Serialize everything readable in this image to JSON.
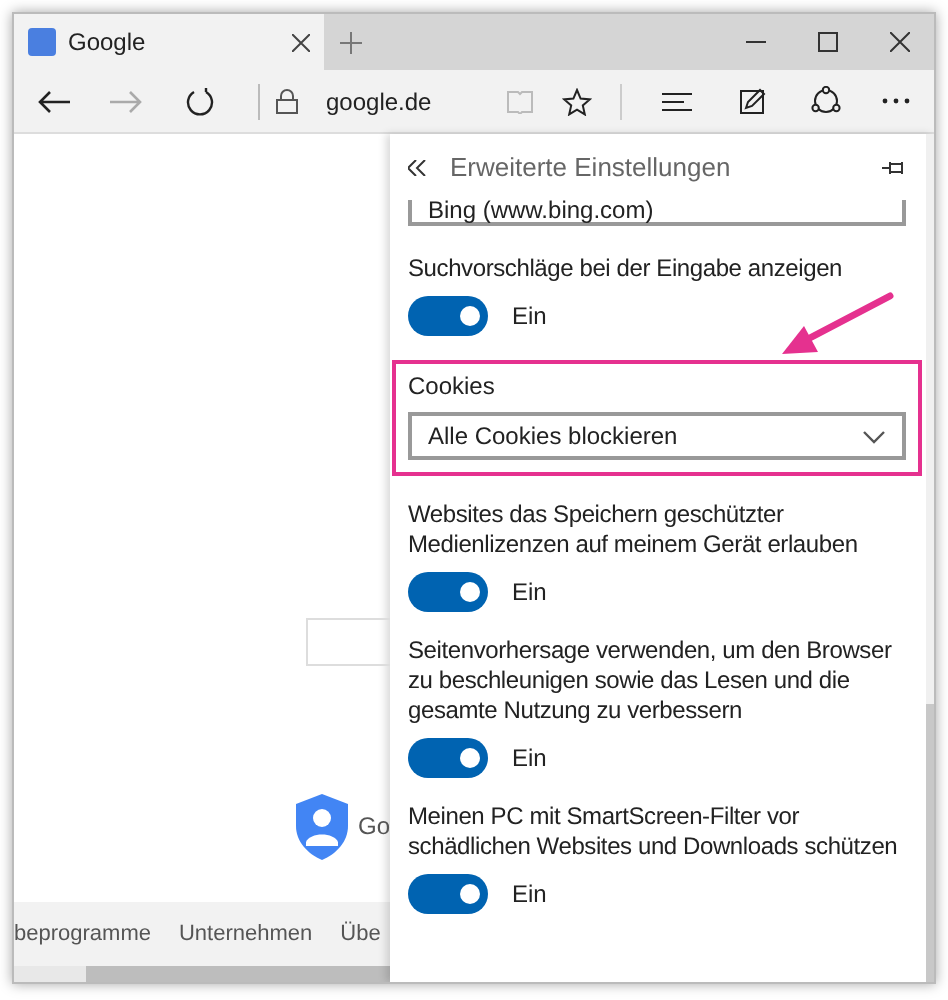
{
  "window": {
    "tab_title": "Google",
    "address": "google.de"
  },
  "page": {
    "brand_fragment": "Go",
    "footer_links": [
      "beprogramme",
      "Unternehmen",
      "Übe"
    ]
  },
  "panel": {
    "title": "Erweiterte Einstellungen",
    "search_engine": "Bing (www.bing.com)",
    "settings": [
      {
        "kind": "toggle",
        "label": "Suchvorschläge bei der Eingabe anzeigen",
        "on": true,
        "state_label": "Ein",
        "highlighted": false
      },
      {
        "kind": "select",
        "label": "Cookies",
        "value": "Alle Cookies blockieren",
        "highlighted": true
      },
      {
        "kind": "toggle",
        "label": "Websites das Speichern geschützter Medienlizenzen auf meinem Gerät erlauben",
        "on": true,
        "state_label": "Ein",
        "highlighted": false
      },
      {
        "kind": "toggle",
        "label": "Seitenvorhersage verwenden, um den Browser zu beschleunigen sowie das Lesen und die gesamte Nutzung zu verbessern",
        "on": true,
        "state_label": "Ein",
        "highlighted": false
      },
      {
        "kind": "toggle",
        "label": "Meinen PC mit SmartScreen-Filter vor schädlichen Websites und Downloads schützen",
        "on": true,
        "state_label": "Ein",
        "highlighted": false
      }
    ]
  }
}
